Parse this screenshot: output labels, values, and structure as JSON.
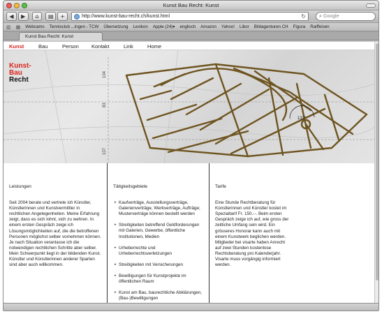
{
  "window": {
    "title": "Kunst Bau Recht: Kunst"
  },
  "toolbar": {
    "back_glyph": "◀",
    "forward_glyph": "▶",
    "home_glyph": "⌂",
    "print_glyph": "▤",
    "add_glyph": "+",
    "url": "http://www.kunst-bau-recht.ch/kunst.html",
    "reload_glyph": "↻",
    "search_placeholder": "Google",
    "search_glyph": "⌕"
  },
  "bookmarks": {
    "book_glyph": "▥",
    "grid_glyph": "▦",
    "items": [
      "Webcams",
      "Tennisclub ...ingen - TCW",
      "Übersetzung",
      "Lexikon",
      "Apple (24)▾",
      "englisch",
      "Amazon",
      "Yahoo!",
      "Libor",
      "Bildagenturen CH",
      "Figura",
      "Raiffeisen"
    ]
  },
  "tab": {
    "label": "Kunst Bau Recht: Kunst"
  },
  "nav": {
    "items": [
      "Kunst",
      "Bau",
      "Person",
      "Kontakt",
      "Link",
      "Home"
    ],
    "active": "Kunst"
  },
  "logo": {
    "line1": "Kunst-",
    "line2": "Bau",
    "line3": "Recht"
  },
  "hero": {
    "marks": [
      "104",
      "83",
      "107"
    ],
    "angle": "132°"
  },
  "columns": {
    "leistungen": {
      "heading": "Leistungen",
      "text": "Seit 2004 berate und vertrete ich Künstler, Künstlerinnen und Kunstvermittler in rechtlichen Angelegenheiten. Meine Erfahrung zeigt, dass es sich lohnt, sich zu wehren. In einem ersten Gespräch zeige ich Lösungsmöglichkeiten auf, die die betroffenen Personen möglichst selber vornehmen können. Je nach Situation veranlasse ich die notwendigen rechtlichen Schritte aber selber. Mein Schwerpunkt liegt in der bildenden Kunst. Künstler und Künstlerinnen anderer Sparten sind aber auch willkommen."
    },
    "taetigkeit": {
      "heading": "Tätigkeitsgebiete",
      "items": [
        "Kaufverträge, Ausstellungsverträge, Galerienverträge, Werkverträge, Aufträge; Musterverträge können bestellt werden",
        "Streitigkeiten betreffend Geldforderungen mit Galerien, Gewerbe, öffentliche Institutionen, Medien",
        "Urheberrechte und Urheberrechtsverletzungen",
        "Streitigkeiten mit Versicherungen",
        "Bewilligungen für Kunstprojekte im öffentlichen Raum",
        "Kunst am Bau, baurechtliche Abklärungen, (Bau-)Bewilligungen"
      ]
    },
    "tarife": {
      "heading": "Tarife",
      "text": "Eine Stunde Rechtberatung für Künstlerinnen und Künstler kostet im Spezialtarif Fr. 150.--. Beim ersten Gespräch zeige ich auf, wie gross der zeitliche Umfang sein wird. Ein grösseres Honorar kann auch mit einem Kunstwerk beglichen werden. Mitglieder bei visarte haben Anrecht auf zwei Stunden kostenlose Rechtsberatung pro Kalenderjahr. Visarte muss vorgängig informiert werden."
    }
  },
  "colors": {
    "accent": "#d8241d",
    "ink": "#222222",
    "drawing": "#6e5420"
  }
}
